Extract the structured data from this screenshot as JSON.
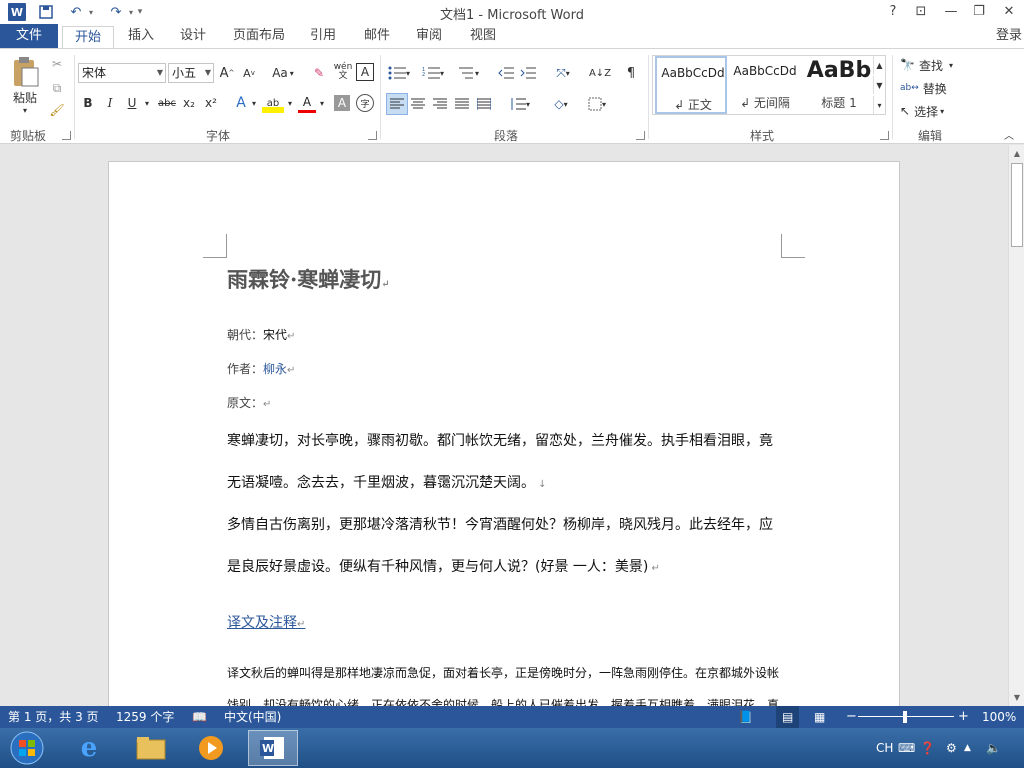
{
  "window": {
    "title": "文档1 - Microsoft Word",
    "controls": {
      "help": "?",
      "ribbon_opts": "⊡",
      "minimize": "—",
      "restore": "❐",
      "close": "✕"
    }
  },
  "quick_access": {
    "save": "💾",
    "undo": "↶",
    "redo": "↷",
    "customize": "▾"
  },
  "tabs": {
    "file": "文件",
    "items": [
      "开始",
      "插入",
      "设计",
      "页面布局",
      "引用",
      "邮件",
      "审阅",
      "视图"
    ],
    "active": "开始",
    "login": "登录"
  },
  "ribbon": {
    "clipboard": {
      "label": "剪贴板",
      "paste": "粘贴"
    },
    "font": {
      "label": "字体",
      "font_name": "宋体",
      "font_size": "小五",
      "bold": "B",
      "italic": "I",
      "underline": "U",
      "strike": "abc",
      "sub": "x₂",
      "sup": "x²",
      "grow": "A",
      "shrink": "A",
      "case": "Aa",
      "phonetic": "wén",
      "border_char": "A",
      "clear": "✎",
      "effects": "A",
      "highlight": "ab",
      "color": "A",
      "shade": "A",
      "enclose": "字"
    },
    "paragraph": {
      "label": "段落"
    },
    "styles": {
      "label": "样式",
      "items": [
        {
          "preview": "AaBbCcDd",
          "name": "↲ 正文"
        },
        {
          "preview": "AaBbCcDd",
          "name": "↲ 无间隔"
        },
        {
          "preview": "AaBb",
          "name": "标题 1"
        }
      ]
    },
    "editing": {
      "label": "编辑",
      "find": "查找",
      "replace": "替换",
      "select": "选择"
    }
  },
  "document": {
    "title": "雨霖铃·寒蝉凄切",
    "meta": [
      {
        "label": "朝代：",
        "value": "宋代"
      },
      {
        "label": "作者：",
        "value": "柳永"
      },
      {
        "label": "原文：",
        "value": ""
      }
    ],
    "body": [
      "寒蝉凄切，对长亭晚，骤雨初歇。都门帐饮无绪，留恋处，兰舟催发。执手相看泪眼，竟",
      "无语凝噎。念去去，千里烟波，暮霭沉沉楚天阔。",
      "多情自古伤离别，更那堪冷落清秋节！今宵酒醒何处？杨柳岸，晓风残月。此去经年，应",
      "是良辰好景虚设。便纵有千种风情，更与何人说？(好景 一人：美景)"
    ],
    "section_link": "译文及注释",
    "trans": [
      "译文秋后的蝉叫得是那样地凄凉而急促，面对着长亭，正是傍晚时分，一阵急雨刚停住。在京都城外设帐",
      "饯别，却没有畅饮的心绪，正在依依不舍的时候，船上的人已催着出发。握着手互相瞧着，满眼泪花，真"
    ]
  },
  "status": {
    "page": "第 1 页，共 3 页",
    "words": "1259 个字",
    "lang": "中文(中国)",
    "zoom": "100%"
  },
  "tray": {
    "ime": "CH"
  }
}
